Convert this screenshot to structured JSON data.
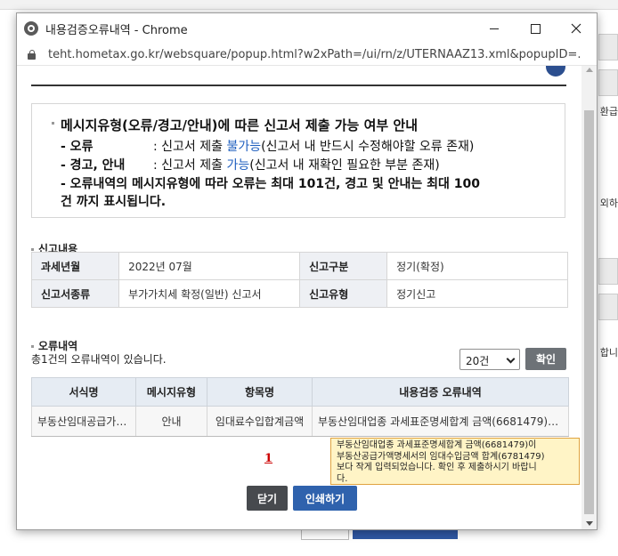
{
  "background": {
    "right_labels": [
      "환급",
      "외하",
      "합니"
    ]
  },
  "window": {
    "title": "내용검증오류내역 - Chrome",
    "url": "teht.hometax.go.kr/websquare/popup.html?w2xPath=/ui/rn/z/UTERNAAZ13.xml&popupID=..."
  },
  "notice": {
    "line1": "메시지유형(오류/경고/안내)에 따른 신고서 제출 가능 여부 안내",
    "error_label": "- 오류",
    "error_pre": ": 신고서 제출 ",
    "error_highlight": "불가능",
    "error_post": "(신고서 내 반드시 수정해야할 오류 존재)",
    "warn_label": "- 경고, 안내",
    "warn_pre": ": 신고서 제출 ",
    "warn_highlight": "가능",
    "warn_post": "(신고서 내 재확인 필요한 부분 존재)",
    "line4": "- 오류내역의 메시지유형에 따라 오류는 최대 101건, 경고 및 안내는 최대 100",
    "line5": "건 까지 표시됩니다."
  },
  "report_section": {
    "heading": "신고내용",
    "rows": [
      {
        "label1": "과세년월",
        "value1": "2022년 07월",
        "label2": "신고구분",
        "value2": "정기(확정)"
      },
      {
        "label1": "신고서종류",
        "value1": "부가가치세 확정(일반) 신고서",
        "label2": "신고유형",
        "value2": "정기신고"
      }
    ]
  },
  "error_section": {
    "heading": "오류내역",
    "count_text": "총1건의 오류내역이 있습니다.",
    "page_size": "20건",
    "confirm_label": "확인",
    "columns": [
      "서식명",
      "메시지유형",
      "항목명",
      "내용검증 오류내역"
    ],
    "rows": [
      [
        "부동산임대공급가액명세서",
        "안내",
        "임대료수입합계금액",
        "부동산임대업종 과세표준명세합계 금액(6681479)이 부동산공급가액명세서의 임대수입금액 합계(6781479)보다 작게 입력되었습니다."
      ]
    ]
  },
  "pager": {
    "current": "1"
  },
  "tooltip": {
    "lines": [
      "부동산임대업종 과세표준명세합계 금액(6681479)이",
      "부동산공급가액명세서의 임대수입금액 합계(6781479)",
      "보다 작게 입력되었습니다. 확인 후 제출하시기 바랍니",
      "다."
    ]
  },
  "buttons": {
    "close_label": "닫기",
    "print_label": "인쇄하기"
  }
}
